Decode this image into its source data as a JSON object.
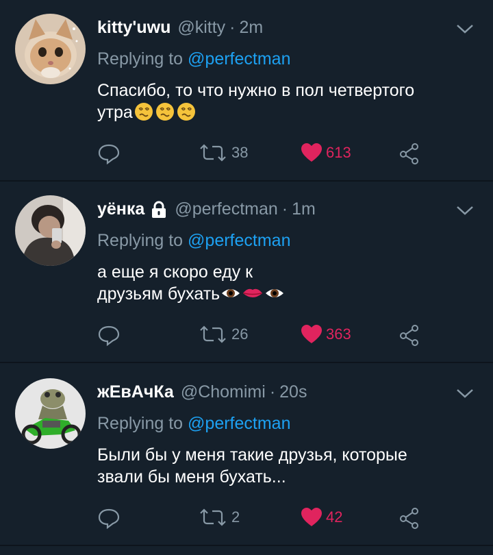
{
  "tweets": [
    {
      "display_name": "kitty'uwu",
      "handle": "@kitty",
      "separator": "·",
      "time": "2m",
      "replying_prefix": "Replying to",
      "replying_to": "@perfectman",
      "text_line1": "Спасибо, то что нужно в пол четвертого",
      "text_line2": "утра",
      "emojis": [
        "face-with-spiral-eyes-icon",
        "face-with-spiral-eyes-icon",
        "face-with-spiral-eyes-icon"
      ],
      "retweets": "38",
      "likes": "613",
      "locked": false
    },
    {
      "display_name": "уёнка",
      "handle": "@perfectman",
      "separator": "·",
      "time": "1m",
      "replying_prefix": "Replying to",
      "replying_to": "@perfectman",
      "text_line1": "а еще я скоро еду к",
      "text_line2": "друзьям бухать",
      "emojis": [
        "eye-icon",
        "lips-icon",
        "eye-icon"
      ],
      "retweets": "26",
      "likes": "363",
      "locked": true
    },
    {
      "display_name": "жЕвАчКа",
      "handle": "@Chomimi",
      "separator": "·",
      "time": "20s",
      "replying_prefix": "Replying to",
      "replying_to": "@perfectman",
      "text_line1": "Были бы у меня такие друзья, которые",
      "text_line2": "звали бы меня бухать...",
      "emojis": [],
      "retweets": "2",
      "likes": "42",
      "locked": false
    }
  ],
  "colors": {
    "background": "#15202b",
    "secondary_text": "#8899a6",
    "link": "#1da1f2",
    "like": "#e0245e"
  }
}
